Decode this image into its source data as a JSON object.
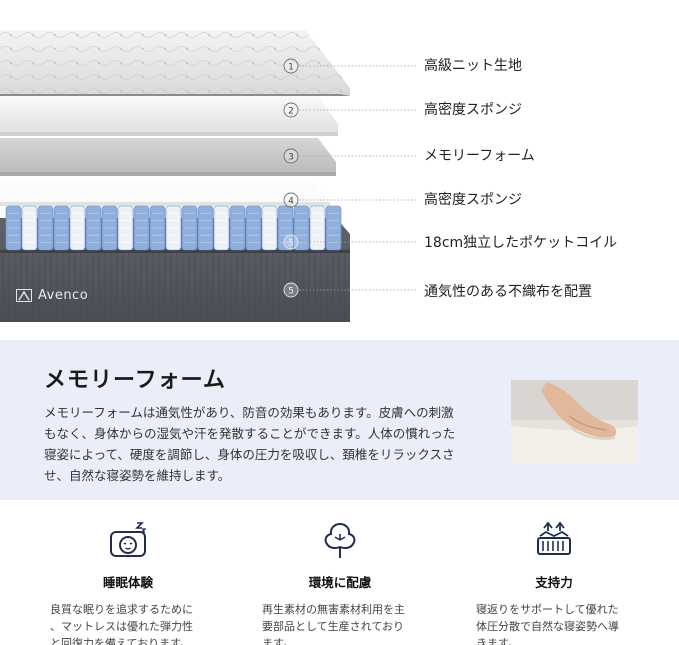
{
  "diagram": {
    "brand": "Avenco",
    "layers": [
      {
        "badge": "1",
        "label": "高級ニット生地"
      },
      {
        "badge": "2",
        "label": "高密度スポンジ"
      },
      {
        "badge": "3",
        "label": "メモリーフォーム"
      },
      {
        "badge": "4",
        "label": "高密度スポンジ"
      },
      {
        "badge": "5",
        "label": "18cm独立したポケットコイル"
      },
      {
        "badge": "5",
        "label": "通気性のある不織布を配置"
      }
    ]
  },
  "memory_section": {
    "title": "メモリーフォーム",
    "description": "メモリーフォームは通気性があり、防音の効果もあります。皮膚への刺激もなく、身体からの湿気や汗を発散することができます。人体の慣れった寝姿によって、硬度を調節し、身体の圧力を吸収し、頚椎をリラックスさせ、自然な寝姿勢を維持します。"
  },
  "features": [
    {
      "icon": "sleeping-face-icon",
      "title": "睡眠体験",
      "description": "良質な眠りを追求するために\n、マットレスは優れた弾力性\nと回復力を備えております。"
    },
    {
      "icon": "cotton-plant-icon",
      "title": "環境に配慮",
      "description": "再生素材の無害素材利用を主\n要部品として生産されており\nます。"
    },
    {
      "icon": "support-mattress-icon",
      "title": "支持力",
      "description": "寝返りをサポートして優れた\n体圧分散で自然な寝姿勢へ導\nきます。"
    }
  ],
  "colors": {
    "accent_navy": "#1f2d4f",
    "section_bg": "#e9eef8",
    "mattress_gray": "#55585e",
    "coil_blue": "#8fb0dd"
  }
}
